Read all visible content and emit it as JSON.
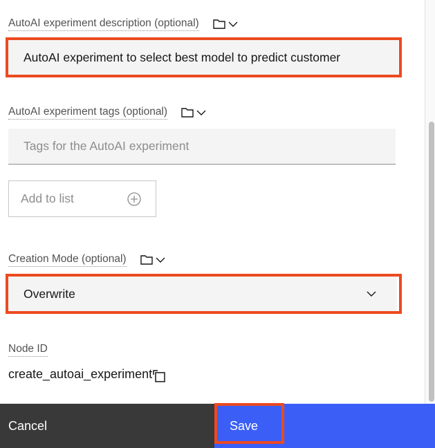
{
  "fields": {
    "description": {
      "label": "AutoAI experiment description (optional)",
      "value": "AutoAI experiment to select best model to predict customer"
    },
    "tags": {
      "label": "AutoAI experiment tags (optional)",
      "placeholder": "Tags for the AutoAI experiment",
      "add_button_label": "Add to list"
    },
    "creation_mode": {
      "label": "Creation Mode (optional)",
      "selected": "Overwrite"
    },
    "node_id": {
      "label": "Node ID",
      "value": "create_autoai_experiment"
    }
  },
  "footer": {
    "cancel_label": "Cancel",
    "save_label": "Save"
  },
  "colors": {
    "highlight": "#ec4a21",
    "primary": "#3b5ff6",
    "secondary": "#393939"
  }
}
